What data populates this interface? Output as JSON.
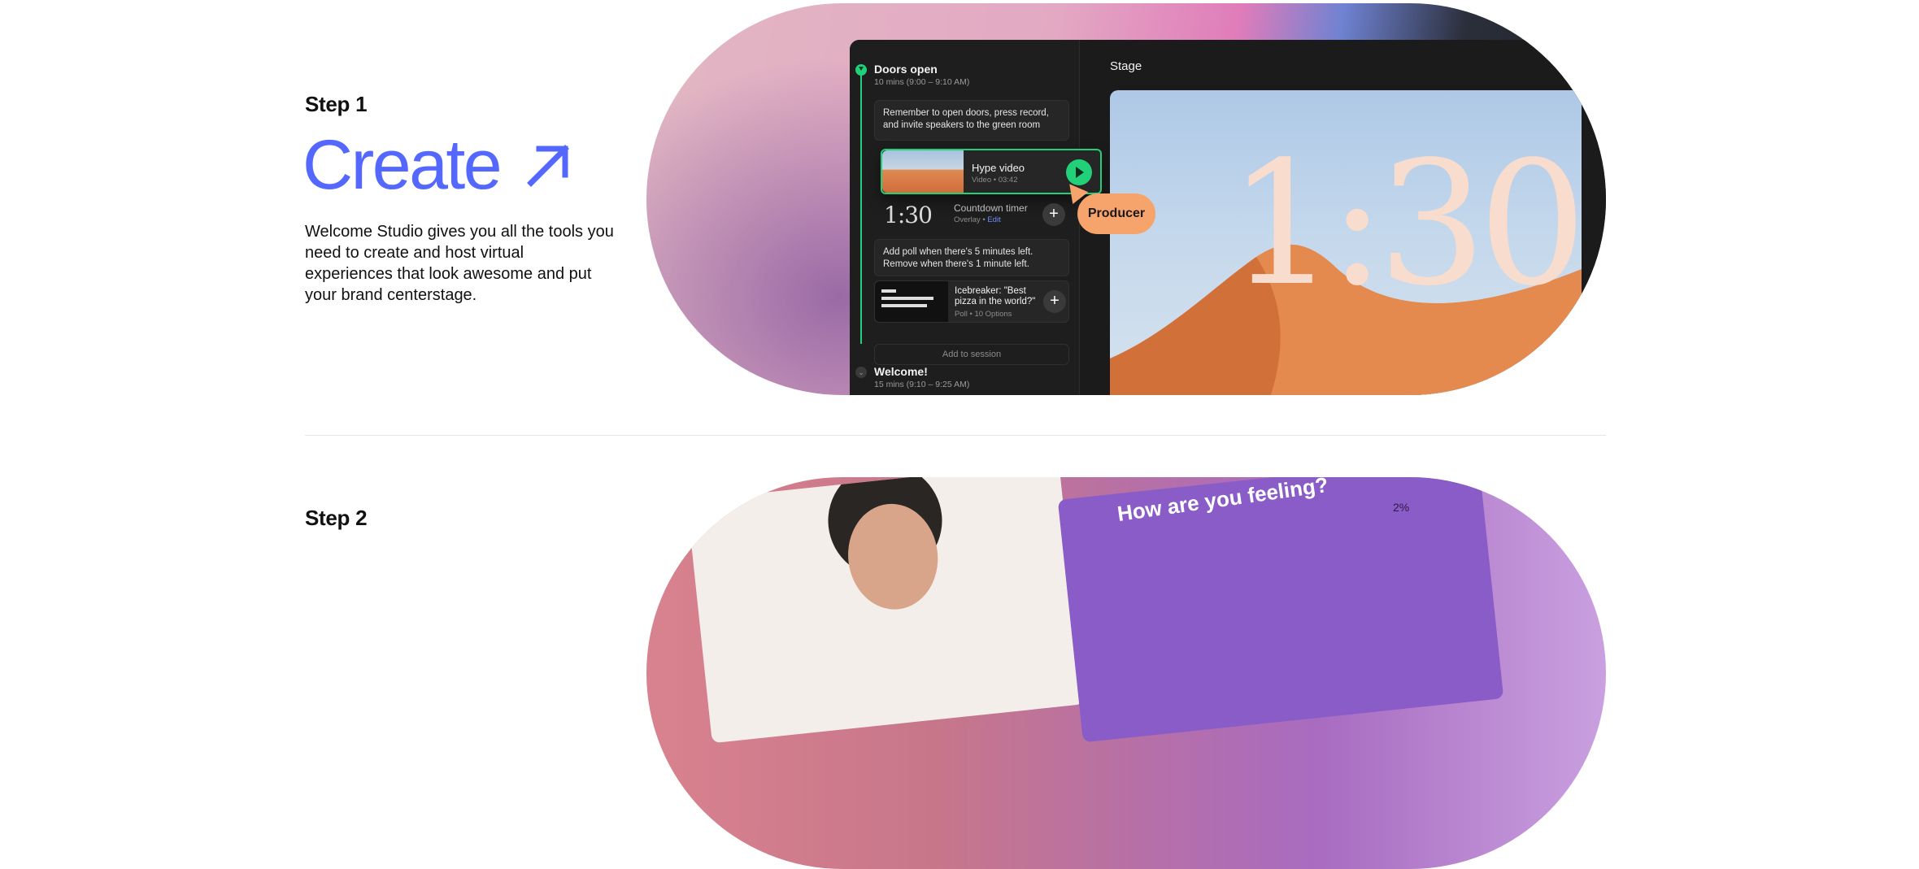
{
  "step1": {
    "label": "Step 1",
    "headline": "Create",
    "description": "Welcome Studio gives you all the tools you need to create and host virtual experiences that look awesome and put your brand centerstage."
  },
  "step2": {
    "label": "Step 2"
  },
  "colors": {
    "accent": "#5468ff",
    "live_green": "#22d07a",
    "producer_orange": "#f6a36c"
  },
  "app": {
    "segments": [
      {
        "title": "Doors open",
        "time": "10 mins (9:00 – 9:10 AM)"
      },
      {
        "title": "Welcome!",
        "time": "15 mins (9:10 – 9:25 AM)"
      }
    ],
    "note1": "Remember to open doors, press record, and invite speakers to the green room",
    "hype": {
      "title": "Hype video",
      "sub": "Video • 03:42"
    },
    "timer": {
      "display": "1:30",
      "title": "Countdown timer",
      "sub": "Overlay • ",
      "edit": "Edit"
    },
    "note2": "Add poll when there's 5 minutes left. Remove when there's 1 minute left.",
    "poll": {
      "title": "Icebreaker: \"Best pizza in the world?\"",
      "sub": "Poll • 10 Options"
    },
    "add_session": "Add to session",
    "stage_label": "Stage",
    "stage_timer": "1:30",
    "producer": "Producer"
  },
  "preview2": {
    "question": "How are you feeling?",
    "percent": "2%"
  },
  "icons": {
    "arrow": "arrow-up-right-icon",
    "play": "play-icon",
    "plus": "plus-icon",
    "chevron": "chevron-down-icon"
  }
}
